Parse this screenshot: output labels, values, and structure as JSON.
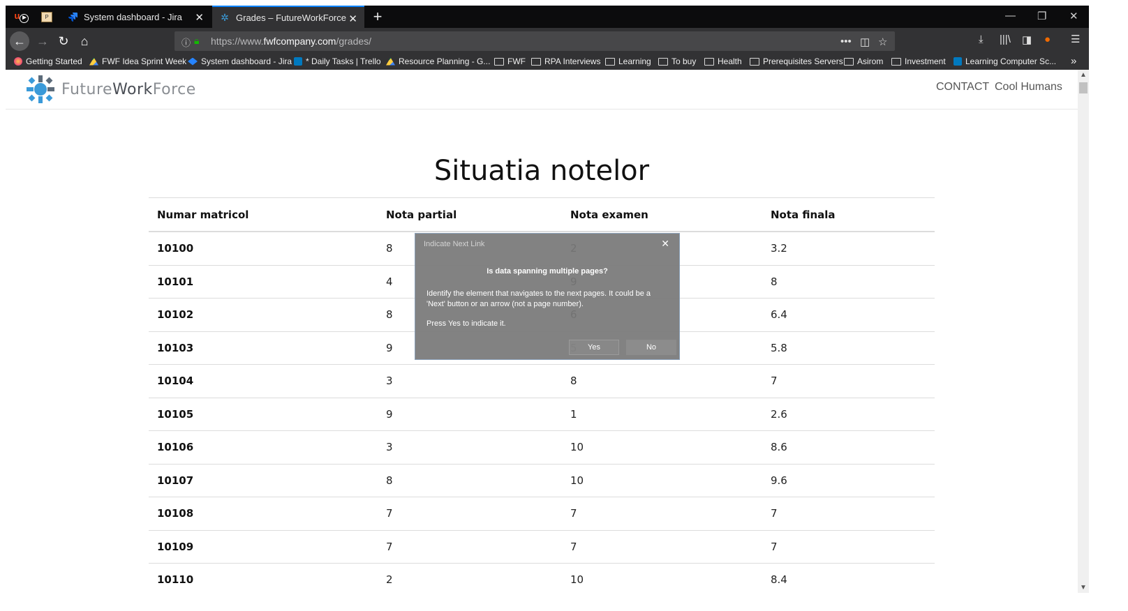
{
  "browser": {
    "tabs": [
      {
        "title": "System dashboard - Jira",
        "active": false,
        "icon": "jira-icon"
      },
      {
        "title": "Grades – FutureWorkForce",
        "active": true,
        "icon": "fwf-icon"
      }
    ],
    "new_tab_label": "+",
    "url_prefix": "https://www.",
    "url_domain": "fwfcompany.com",
    "url_path": "/grades/",
    "bookmarks": [
      {
        "label": "Getting Started",
        "icon": "firefox-icon"
      },
      {
        "label": "FWF Idea Sprint Week",
        "icon": "drive-icon"
      },
      {
        "label": "System dashboard - Jira",
        "icon": "jira-icon"
      },
      {
        "label": "* Daily Tasks | Trello",
        "icon": "trello-icon"
      },
      {
        "label": "Resource Planning - G...",
        "icon": "drive-icon"
      },
      {
        "label": "FWF",
        "icon": "folder-icon"
      },
      {
        "label": "RPA Interviews",
        "icon": "folder-icon"
      },
      {
        "label": "Learning",
        "icon": "folder-icon"
      },
      {
        "label": "To buy",
        "icon": "folder-icon"
      },
      {
        "label": "Health",
        "icon": "folder-icon"
      },
      {
        "label": "Prerequisites Servers",
        "icon": "folder-icon"
      },
      {
        "label": "Asirom",
        "icon": "folder-icon"
      },
      {
        "label": "Investment",
        "icon": "folder-icon"
      },
      {
        "label": "Learning Computer Sc...",
        "icon": "trello-icon"
      }
    ]
  },
  "site": {
    "logo_part1": "Future",
    "logo_part2": "Work",
    "logo_part3": "Force",
    "menu": [
      "CONTACT",
      "Cool Humans"
    ]
  },
  "page": {
    "title": "Situatia notelor",
    "columns": [
      "Numar matricol",
      "Nota partial",
      "Nota examen",
      "Nota finala"
    ],
    "rows": [
      [
        "10100",
        "8",
        "2",
        "3.2"
      ],
      [
        "10101",
        "4",
        "9",
        "8"
      ],
      [
        "10102",
        "8",
        "6",
        "6.4"
      ],
      [
        "10103",
        "9",
        "5",
        "5.8"
      ],
      [
        "10104",
        "3",
        "8",
        "7"
      ],
      [
        "10105",
        "9",
        "1",
        "2.6"
      ],
      [
        "10106",
        "3",
        "10",
        "8.6"
      ],
      [
        "10107",
        "8",
        "10",
        "9.6"
      ],
      [
        "10108",
        "7",
        "7",
        "7"
      ],
      [
        "10109",
        "7",
        "7",
        "7"
      ],
      [
        "10110",
        "2",
        "10",
        "8.4"
      ]
    ]
  },
  "dialog": {
    "title": "Indicate Next Link",
    "question": "Is data spanning multiple pages?",
    "body": "Identify the element that navigates to the next pages. It could be a 'Next' button or an arrow (not a page number).",
    "press": "Press Yes to indicate it.",
    "yes_label": "Yes",
    "no_label": "No"
  }
}
